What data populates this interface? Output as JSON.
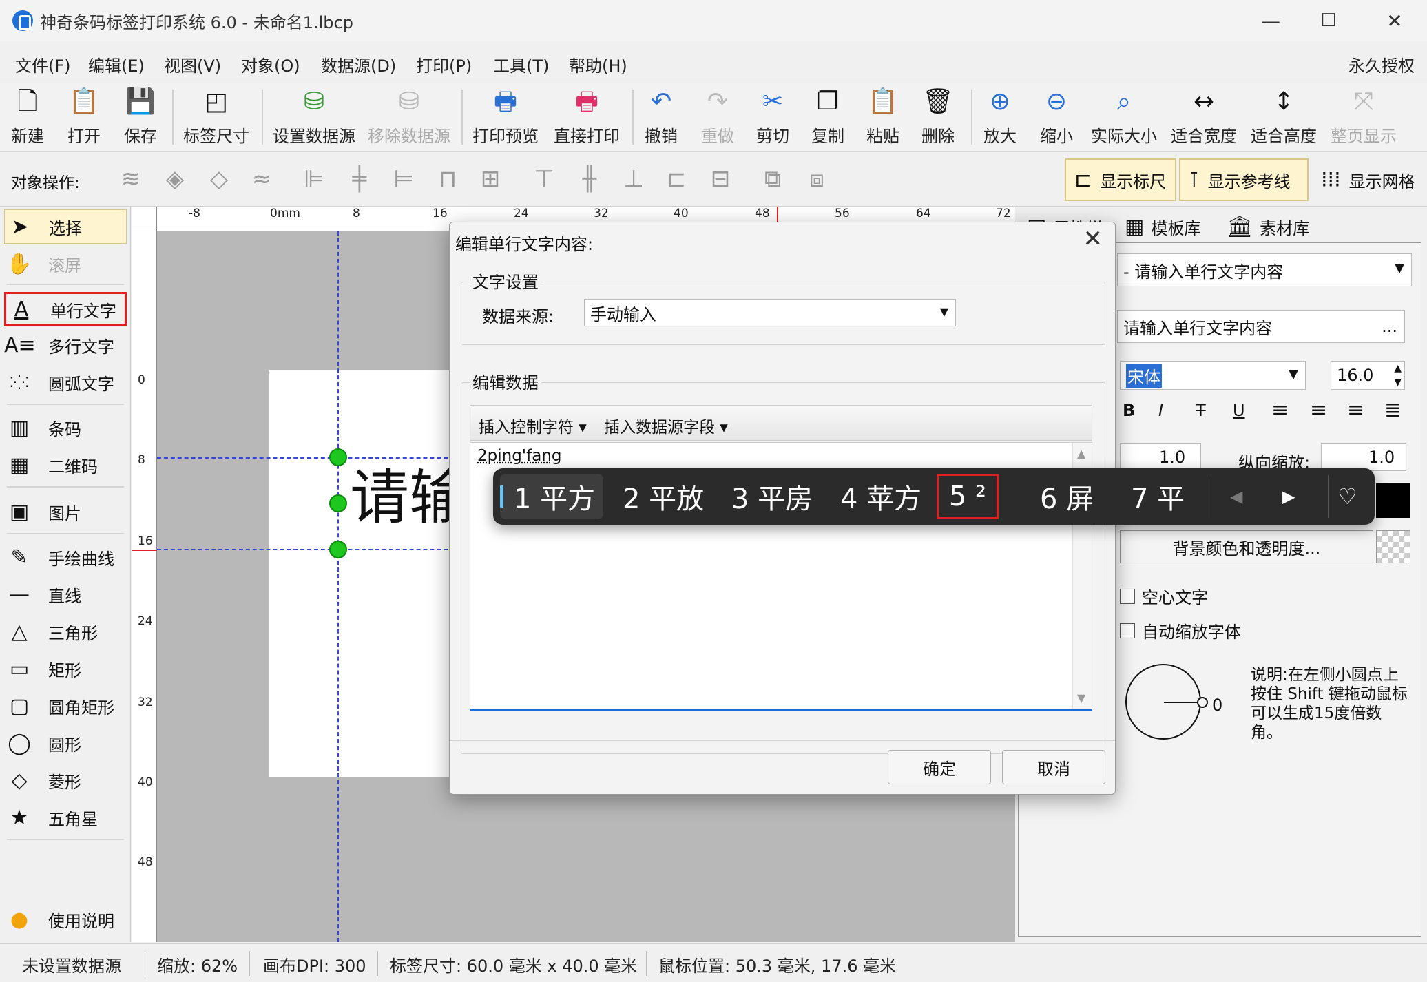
{
  "window": {
    "title": "神奇条码标签打印系统 6.0 - 未命名1.lbcp",
    "minimize": "—",
    "maximize": "☐",
    "close": "✕"
  },
  "menu": {
    "items": [
      "文件(F)",
      "编辑(E)",
      "视图(V)",
      "对象(O)",
      "数据源(D)",
      "打印(P)",
      "工具(T)",
      "帮助(H)"
    ],
    "license": "永久授权"
  },
  "toolbar": {
    "items": [
      {
        "label": "新建",
        "icon": "new-file-icon"
      },
      {
        "label": "打开",
        "icon": "open-icon"
      },
      {
        "label": "保存",
        "icon": "save-icon"
      },
      {
        "label": "标签尺寸",
        "icon": "label-size-icon"
      },
      {
        "label": "设置数据源",
        "icon": "datasource-icon"
      },
      {
        "label": "移除数据源",
        "icon": "remove-datasource-icon"
      },
      {
        "label": "打印预览",
        "icon": "print-preview-icon"
      },
      {
        "label": "直接打印",
        "icon": "print-icon"
      },
      {
        "label": "撤销",
        "icon": "undo-icon"
      },
      {
        "label": "重做",
        "icon": "redo-icon"
      },
      {
        "label": "剪切",
        "icon": "cut-icon"
      },
      {
        "label": "复制",
        "icon": "copy-icon"
      },
      {
        "label": "粘贴",
        "icon": "paste-icon"
      },
      {
        "label": "删除",
        "icon": "delete-icon"
      },
      {
        "label": "放大",
        "icon": "zoom-in-icon"
      },
      {
        "label": "缩小",
        "icon": "zoom-out-icon"
      },
      {
        "label": "实际大小",
        "icon": "actual-size-icon"
      },
      {
        "label": "适合宽度",
        "icon": "fit-width-icon"
      },
      {
        "label": "适合高度",
        "icon": "fit-height-icon"
      },
      {
        "label": "整页显示",
        "icon": "fit-page-icon"
      }
    ]
  },
  "object_bar": {
    "label": "对象操作:",
    "show_ruler": "显示标尺",
    "show_guides": "显示参考线",
    "show_grid": "显示网格"
  },
  "tools": {
    "items": [
      "选择",
      "滚屏",
      "单行文字",
      "多行文字",
      "圆弧文字",
      "条码",
      "二维码",
      "图片",
      "手绘曲线",
      "直线",
      "三角形",
      "矩形",
      "圆角矩形",
      "圆形",
      "菱形",
      "五角星"
    ],
    "help": "使用说明"
  },
  "ruler": {
    "top": [
      "-8",
      "0mm",
      "8",
      "16",
      "24",
      "32",
      "40",
      "48",
      "56",
      "64",
      "72"
    ],
    "left": [
      "0",
      "8",
      "16",
      "24",
      "32",
      "40",
      "48"
    ]
  },
  "canvas": {
    "text": "请输入单行文字内容"
  },
  "right_panel": {
    "tabs": [
      "属性栏",
      "模板库",
      "素材库"
    ],
    "object_select": "- 请输入单行文字内容",
    "content": "请输入单行文字内容",
    "content_btn": "...",
    "font": "宋体",
    "font_size": "16.0",
    "style_buttons": [
      "B",
      "I",
      "T",
      "U"
    ],
    "h_scale": "1.0",
    "v_scale_label": "纵向缩放:",
    "v_scale": "1.0",
    "bg_button": "背景颜色和透明度...",
    "hollow": "空心文字",
    "autoscale": "自动缩放字体",
    "angle": "0",
    "note": "说明:在左侧小圆点上按住 Shift 键拖动鼠标可以生成15度倍数角。"
  },
  "dialog": {
    "title": "编辑单行文字内容:",
    "text_settings": "文字设置",
    "source_label": "数据来源:",
    "source_value": "手动输入",
    "edit_data": "编辑数据",
    "insert_ctrl": "插入控制字符",
    "insert_field": "插入数据源字段",
    "input_text": "2ping'fang",
    "ok": "确定",
    "cancel": "取消"
  },
  "ime": {
    "candidates": [
      "1 平方",
      "2 平放",
      "3 平房",
      "4 苹方",
      "5 ²",
      "6 屏",
      "7 平"
    ]
  },
  "status": {
    "datasource": "未设置数据源",
    "zoom": "缩放: 62%",
    "dpi": "画布DPI: 300",
    "size": "标签尺寸: 60.0 毫米 x 40.0 毫米",
    "mouse": "鼠标位置: 50.3 毫米, 17.6 毫米"
  }
}
